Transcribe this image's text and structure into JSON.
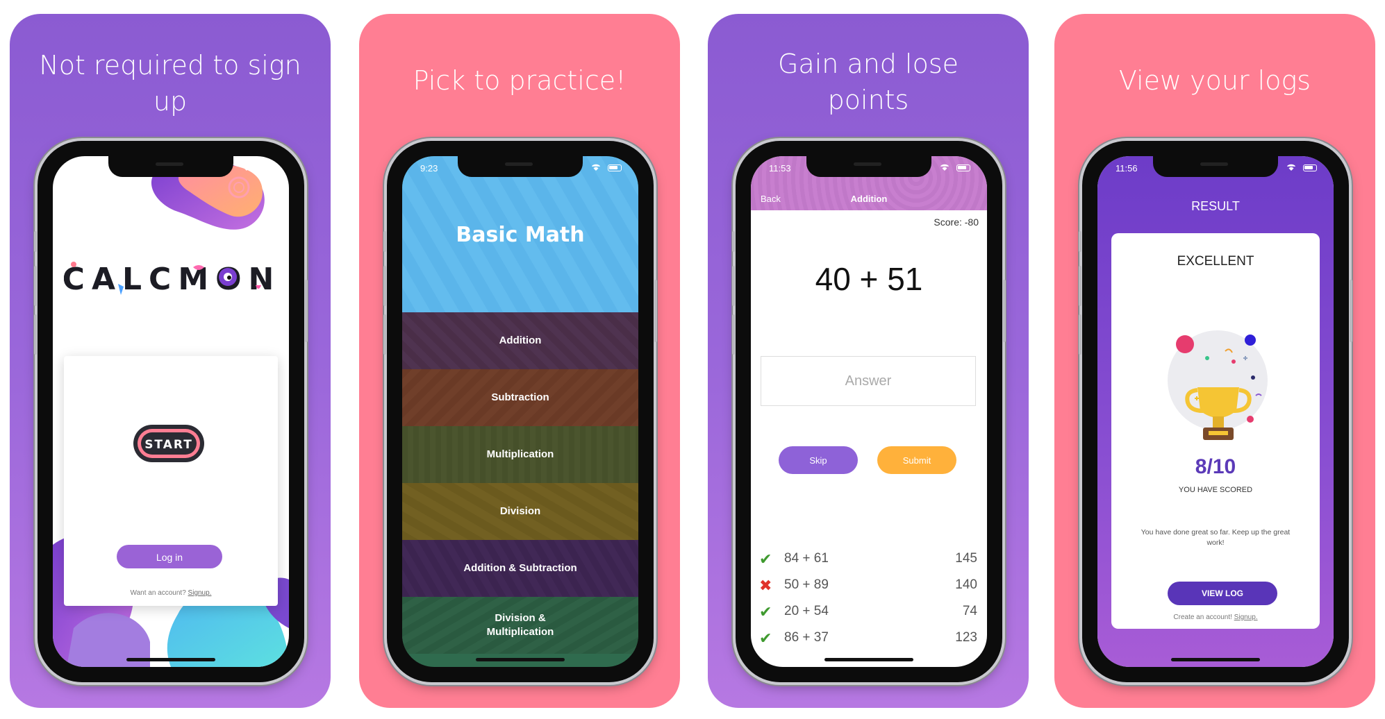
{
  "colors": {
    "purple_panel": "#8b5bd2",
    "pink_panel": "#ff7e93",
    "skip_button": "#8e62d8",
    "submit_button": "#ffb13b",
    "view_log_button": "#5935b8",
    "correct_mark": "#3f9a2f",
    "wrong_mark": "#e0332b"
  },
  "panels": [
    {
      "caption": "Not required to sign up",
      "screen": {
        "logo_text": "CALCMON",
        "start_label": "START",
        "login_label": "Log in",
        "account_prompt": "Want an account?",
        "signup_link": "Signup."
      }
    },
    {
      "caption": "Pick to practice!",
      "screen": {
        "time": "9:23",
        "title": "Basic Math",
        "items": [
          "Addition",
          "Subtraction",
          "Multiplication",
          "Division",
          "Addition & Subtraction",
          "Division & Multiplication"
        ]
      }
    },
    {
      "caption": "Gain and lose points",
      "screen": {
        "time": "11:53",
        "back_label": "Back",
        "nav_title": "Addition",
        "score": "Score: -80",
        "question": "40 + 51",
        "answer_placeholder": "Answer",
        "skip_label": "Skip",
        "submit_label": "Submit",
        "log": [
          {
            "expr": "84 + 61",
            "answer": "145",
            "correct": true
          },
          {
            "expr": "50 + 89",
            "answer": "140",
            "correct": false
          },
          {
            "expr": "20 + 54",
            "answer": "74",
            "correct": true
          },
          {
            "expr": "86 + 37",
            "answer": "123",
            "correct": true
          }
        ]
      }
    },
    {
      "caption": "View your logs",
      "screen": {
        "time": "11:56",
        "header": "RESULT",
        "rating": "EXCELLENT",
        "score": "8/10",
        "score_caption": "YOU HAVE SCORED",
        "message": "You have done great so far. Keep up the great work!",
        "view_log_label": "VIEW LOG",
        "create_prompt": "Create an account!",
        "signup_link": "Signup."
      }
    }
  ]
}
